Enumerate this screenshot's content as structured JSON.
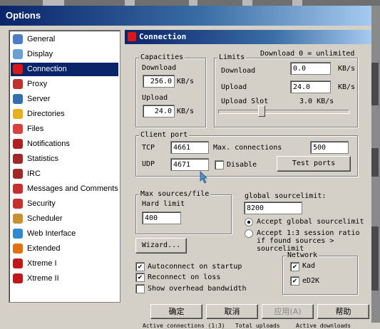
{
  "window": {
    "title": "Options"
  },
  "sidebar": {
    "items": [
      {
        "label": "General",
        "color": "#4a7cc9"
      },
      {
        "label": "Display",
        "color": "#6aa0d8"
      },
      {
        "label": "Connection",
        "color": "#d81818",
        "selected": true
      },
      {
        "label": "Proxy",
        "color": "#c03030"
      },
      {
        "label": "Server",
        "color": "#3070b0"
      },
      {
        "label": "Directories",
        "color": "#e8b020"
      },
      {
        "label": "Files",
        "color": "#d84040"
      },
      {
        "label": "Notifications",
        "color": "#b02020"
      },
      {
        "label": "Statistics",
        "color": "#a02828"
      },
      {
        "label": "IRC",
        "color": "#a02828"
      },
      {
        "label": "Messages and Comments",
        "color": "#c83030"
      },
      {
        "label": "Security",
        "color": "#c83030"
      },
      {
        "label": "Scheduler",
        "color": "#c89030"
      },
      {
        "label": "Web Interface",
        "color": "#2f8ad0"
      },
      {
        "label": "Extended",
        "color": "#e07010"
      },
      {
        "label": "Xtreme I",
        "color": "#c01818"
      },
      {
        "label": "Xtreme II",
        "color": "#c01818"
      }
    ]
  },
  "panel": {
    "header": "Connection",
    "capacities": {
      "title": "Capacities",
      "download_label": "Download",
      "download_value": "256.0",
      "download_unit": "KB/s",
      "upload_label": "Upload",
      "upload_value": "24.0",
      "upload_unit": "KB/s"
    },
    "limits": {
      "title": "Limits",
      "note": "Download 0 = unlimited",
      "download_label": "Download",
      "download_value": "0.0",
      "download_unit": "KB/s",
      "upload_label": "Upload",
      "upload_value": "24.0",
      "upload_unit": "KB/s",
      "slot_label": "Upload Slot",
      "slot_value": "3.0 KB/s",
      "slider_level": 0.32
    },
    "client_port": {
      "title": "Client port",
      "tcp_label": "TCP",
      "tcp_value": "4661",
      "udp_label": "UDP",
      "udp_value": "4671",
      "disable_label": "Disable",
      "disable_checked": false,
      "max_conn_label": "Max. connections",
      "max_conn_value": "500",
      "test_button": "Test ports"
    },
    "max_sources": {
      "title": "Max sources/file",
      "hard_label": "Hard limit",
      "hard_value": "400"
    },
    "global": {
      "label": "global sourcelimit:",
      "value": "8200",
      "opt1": "Accept global sourcelimit",
      "opt2_line1": "Accept 1:3 session ratio",
      "opt2_line2": "if found sources >",
      "opt2_line3": "sourcelimit",
      "selected": "opt1"
    },
    "wizard_button": "Wizard...",
    "autoconnect": {
      "label": "Autoconnect on startup",
      "checked": true
    },
    "reconnect": {
      "label": "Reconnect on loss",
      "checked": true
    },
    "overhead": {
      "label": "Show overhead bandwidth",
      "checked": false
    },
    "network": {
      "title": "Network",
      "kad": {
        "label": "Kad",
        "checked": true
      },
      "ed2k": {
        "label": "eD2K",
        "checked": true
      }
    }
  },
  "buttons": {
    "ok": "确定",
    "cancel": "取消",
    "apply": "应用(A)",
    "help": "帮助"
  },
  "background": {
    "status1": "Active connections (1:3)",
    "status2": "Total uploads",
    "status3": "Active downloads"
  }
}
